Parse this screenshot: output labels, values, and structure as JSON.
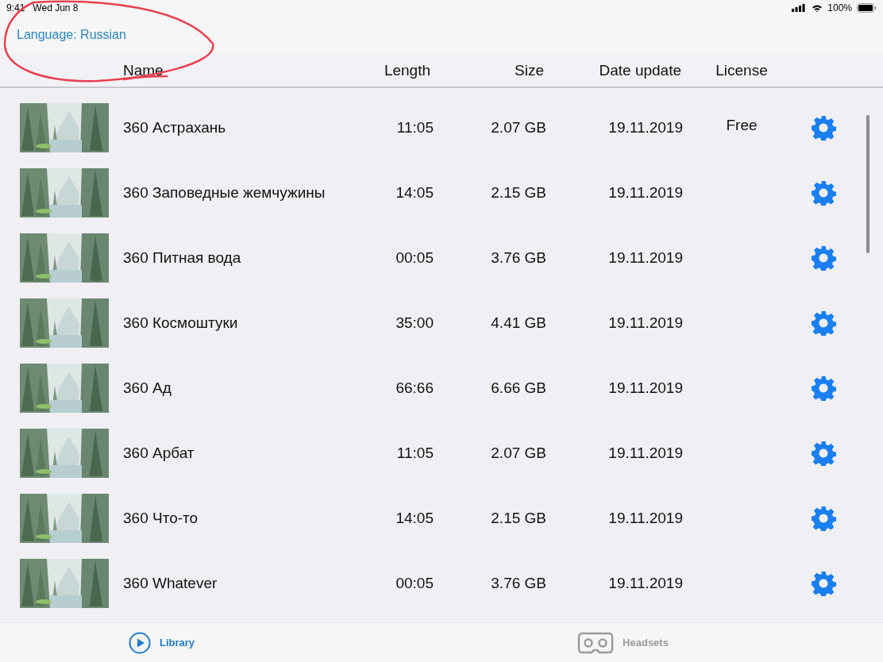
{
  "status_bar": {
    "time": "9:41",
    "date": "Wed Jun 8",
    "battery": "100%"
  },
  "language": "Language: Russian",
  "columns": [
    "Name",
    "Length",
    "Size",
    "Date update",
    "License"
  ],
  "rows": [
    {
      "name": "360 Астрахань",
      "length": "11:05",
      "size": "2.07 GB",
      "date": "19.11.2019",
      "license": "Free"
    },
    {
      "name": "360 Заповедные жемчужины",
      "length": "14:05",
      "size": "2.15 GB",
      "date": "19.11.2019"
    },
    {
      "name": "360 Питная вода",
      "length": "00:05",
      "size": "3.76 GB",
      "date": "19.11.2019"
    },
    {
      "name": "360 Космоштуки",
      "length": "35:00",
      "size": "4.41 GB",
      "date": "19.11.2019"
    },
    {
      "name": "360 Ад",
      "length": "66:66",
      "size": "6.66 GB",
      "date": "19.11.2019"
    },
    {
      "name": "360 Арбат",
      "length": "11:05",
      "size": "2.07 GB",
      "date": "19.11.2019"
    },
    {
      "name": "360 Что-то",
      "length": "14:05",
      "size": "2.15 GB",
      "date": "19.11.2019"
    },
    {
      "name": "360 Whatever",
      "length": "00:05",
      "size": "3.76 GB",
      "date": "19.11.2019"
    }
  ],
  "tabs": [
    {
      "label": "Library",
      "kind": "play",
      "selected": true
    },
    {
      "label": "Headsets",
      "kind": "headset",
      "selected": false
    }
  ]
}
